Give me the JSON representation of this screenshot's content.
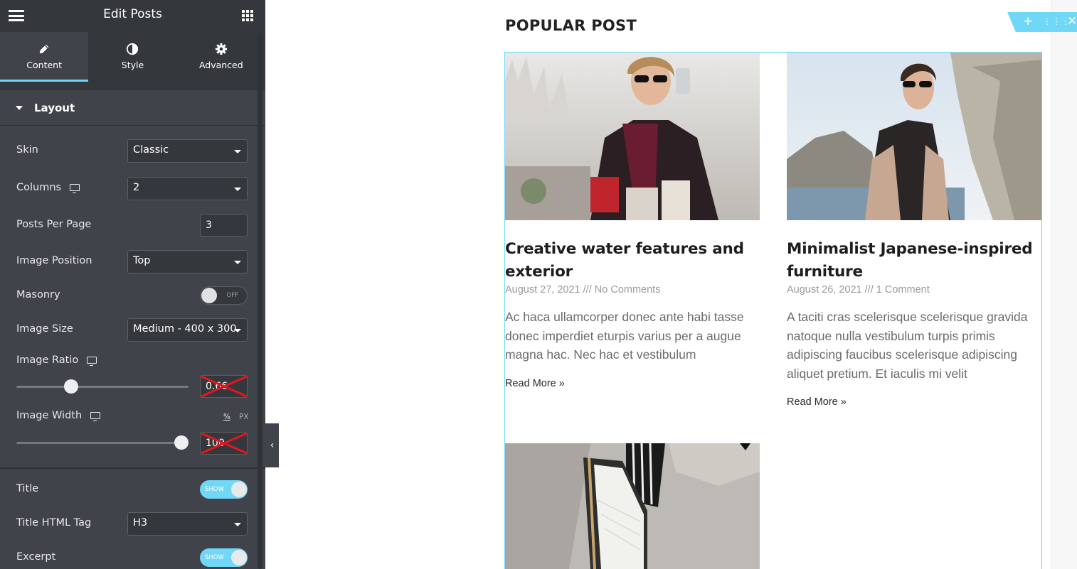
{
  "panel": {
    "title": "Edit Posts",
    "tabs": [
      {
        "label": "Content",
        "icon": "pencil-icon"
      },
      {
        "label": "Style",
        "icon": "contrast-icon"
      },
      {
        "label": "Advanced",
        "icon": "gear-icon"
      }
    ],
    "section": "Layout",
    "controls": {
      "skin": {
        "label": "Skin",
        "value": "Classic"
      },
      "columns": {
        "label": "Columns",
        "value": "2"
      },
      "posts_per_page": {
        "label": "Posts Per Page",
        "value": "3"
      },
      "image_position": {
        "label": "Image Position",
        "value": "Top"
      },
      "masonry": {
        "label": "Masonry",
        "state": "OFF"
      },
      "image_size": {
        "label": "Image Size",
        "value": "Medium - 400 x 300"
      },
      "image_ratio": {
        "label": "Image Ratio",
        "value": "0.66",
        "fraction": 0.3
      },
      "image_width": {
        "label": "Image Width",
        "value": "100",
        "fraction": 1.0,
        "unit_pct": "%",
        "unit_px": "PX"
      },
      "title": {
        "label": "Title",
        "state": "SHOW"
      },
      "title_tag": {
        "label": "Title HTML Tag",
        "value": "H3"
      },
      "excerpt": {
        "label": "Excerpt",
        "state": "SHOW"
      }
    }
  },
  "preview": {
    "heading": "POPULAR POST",
    "posts": [
      {
        "title": "Creative water features and exterior",
        "date": "August 27, 2021",
        "separator": "///",
        "comments": "No Comments",
        "excerpt": "Ac haca ullamcorper donec ante habi tasse donec imperdiet eturpis varius per a augue magna hac. Nec hac et vestibulum",
        "read_more": "Read More »"
      },
      {
        "title": "Minimalist Japanese-inspired furniture",
        "date": "August 26, 2021",
        "separator": "///",
        "comments": "1 Comment",
        "excerpt": "A taciti cras scelerisque scelerisque gravida natoque nulla vestibulum turpis primis adipiscing faucibus scelerisque adipiscing aliquet pretium. Et iaculis mi velit",
        "read_more": "Read More »"
      }
    ]
  },
  "colors": {
    "accent": "#71d7f7",
    "panel_bg": "#404349",
    "panel_header": "#34383c"
  }
}
